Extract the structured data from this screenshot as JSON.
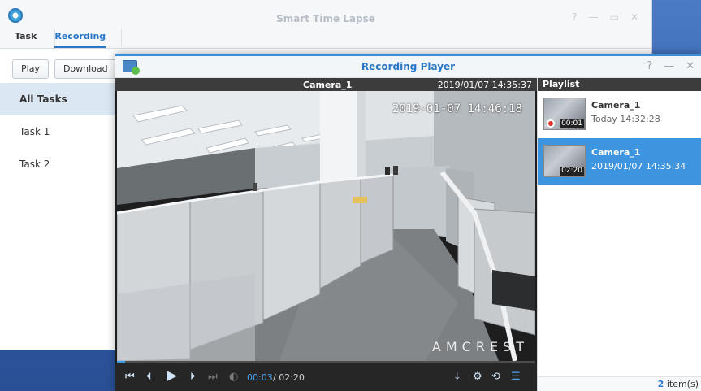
{
  "app": {
    "title": "Smart Time Lapse",
    "window_controls": [
      "?",
      "—",
      "▭",
      "✕"
    ],
    "tabs": [
      {
        "label": "Task",
        "active": false
      },
      {
        "label": "Recording",
        "active": true
      }
    ],
    "toolbar": {
      "play_label": "Play",
      "download_label": "Download"
    },
    "sidebar": [
      {
        "label": "All Tasks",
        "active": true
      },
      {
        "label": "Task 1",
        "active": false
      },
      {
        "label": "Task 2",
        "active": false
      }
    ]
  },
  "player": {
    "title": "Recording Player",
    "window_controls": [
      "?",
      "—",
      "✕"
    ],
    "video": {
      "camera": "Camera_1",
      "datetime": "2019/01/07 14:35:37",
      "overlay_timestamp": "2019-01-07 14:46:18",
      "watermark": "AMCREST",
      "progress": 0.02
    },
    "controls": {
      "current_time": "00:03",
      "total_time": "/ 02:20",
      "icons": [
        "skip-start-icon",
        "prev-frame-icon",
        "play-icon",
        "next-frame-icon",
        "skip-end-icon",
        "volume-icon",
        "download-icon",
        "settings-icon",
        "repeat-icon",
        "list-icon"
      ]
    },
    "playlist": {
      "header": "Playlist",
      "items": [
        {
          "name": "Camera_1",
          "time": "Today 14:32:28",
          "duration": "00:01",
          "recording": true,
          "selected": false
        },
        {
          "name": "Camera_1",
          "time": "2019/01/07 14:35:34",
          "duration": "02:20",
          "recording": false,
          "selected": true
        }
      ],
      "count": "2",
      "count_label": "item(s)"
    }
  },
  "colors": {
    "accent": "#2a77c8",
    "selection": "#3d94df",
    "desktop": "#3a67b0"
  }
}
